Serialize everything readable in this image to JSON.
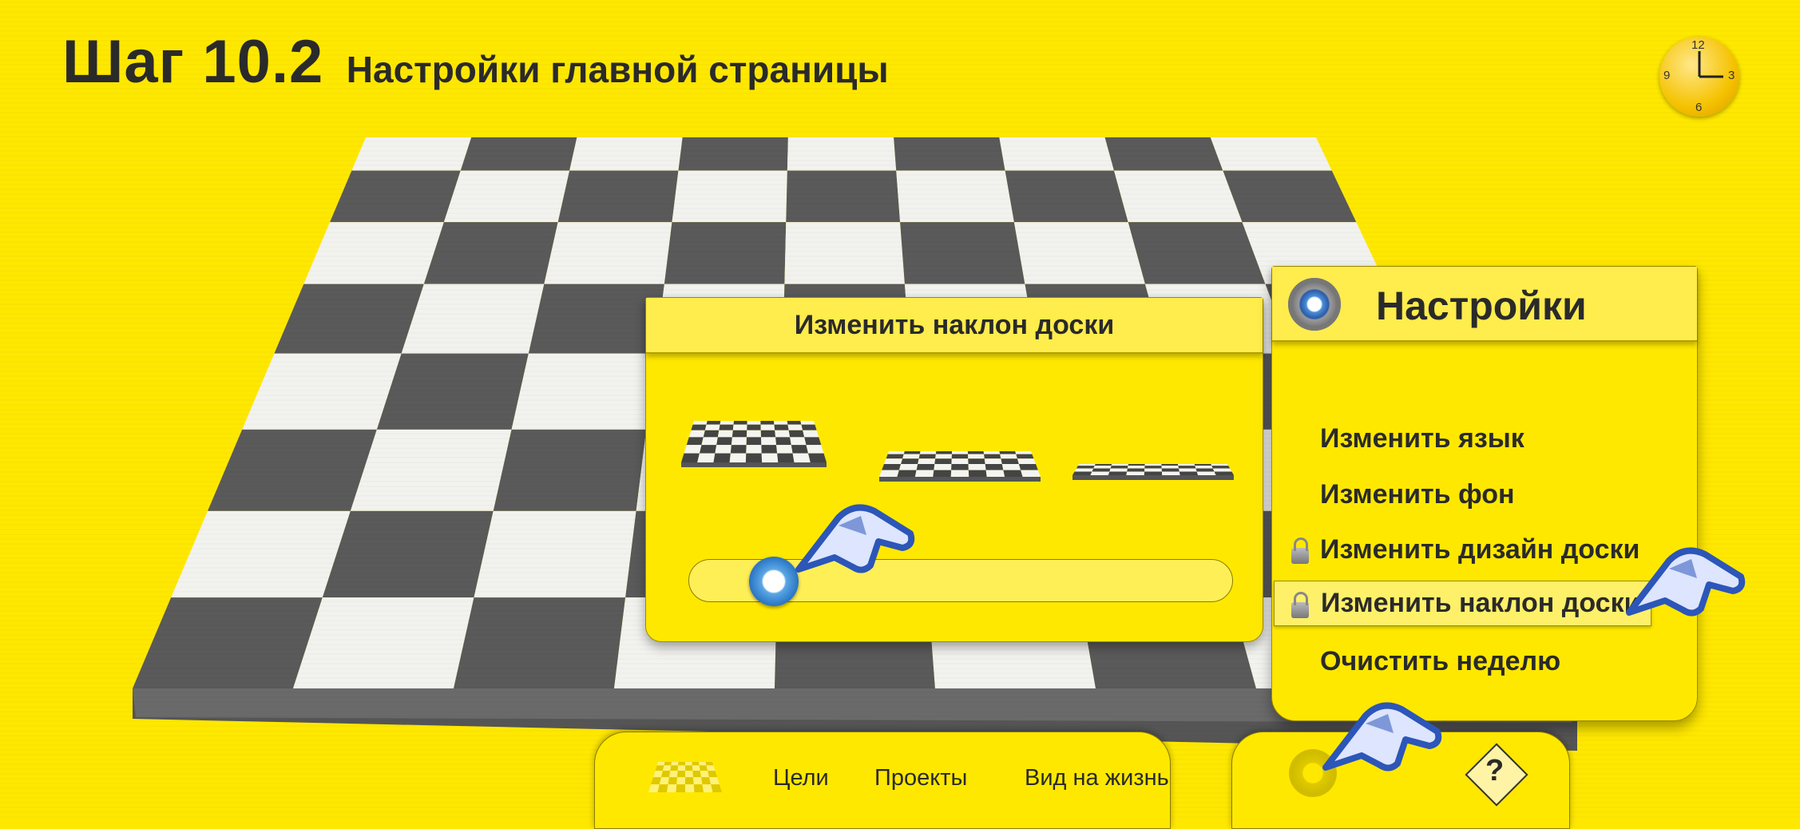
{
  "header": {
    "step": "Шаг 10.2",
    "subtitle": "Настройки главной страницы"
  },
  "clock": {
    "numbers": [
      "12",
      "3",
      "6",
      "9"
    ]
  },
  "tilt_panel": {
    "title": "Изменить наклон доски",
    "slider_value": 0.12
  },
  "settings_panel": {
    "title": "Настройки",
    "items": [
      {
        "label": "Изменить язык",
        "locked": false
      },
      {
        "label": "Изменить фон",
        "locked": false
      },
      {
        "label": "Изменить дизайн доски",
        "locked": true
      },
      {
        "label": "Изменить наклон доски",
        "locked": true,
        "selected": true
      },
      {
        "label": "Очистить неделю",
        "locked": false
      }
    ]
  },
  "bottom_nav": {
    "items": [
      "Цели",
      "Проекты",
      "Вид на жизнь"
    ],
    "help_label": "?"
  },
  "colors": {
    "background": "#ffe800",
    "accent_blue": "#2a74c2",
    "text": "#2a2a2a"
  }
}
